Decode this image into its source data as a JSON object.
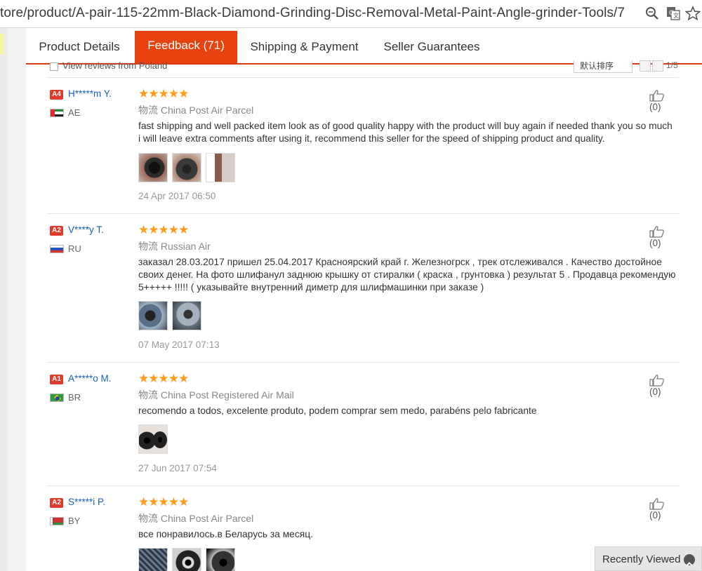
{
  "browser": {
    "url": "tore/product/A-pair-115-22mm-Black-Diamond-Grinding-Disc-Removal-Metal-Paint-Angle-grinder-Tools/7",
    "icons": [
      "zoom-icon",
      "translate-icon",
      "star-icon"
    ]
  },
  "tabs": [
    {
      "label": "Product Details",
      "active": false
    },
    {
      "label": "Feedback (71)",
      "active": true
    },
    {
      "label": "Shipping & Payment",
      "active": false
    },
    {
      "label": "Seller Guarantees",
      "active": false
    }
  ],
  "filter": {
    "view_label": "View reviews from Poland",
    "sort_label": "默认排序",
    "page": "1/5"
  },
  "reviews": [
    {
      "level": "A4",
      "user": "H*****m Y.",
      "country": "AE",
      "stars": "★★★★★",
      "ship_prefix": "物流",
      "shipping": "China Post Air Parcel",
      "text_lines": [
        "fast shipping and well packed item look as of good quality happy with the product will buy again if needed thank you so much",
        "i will leave extra comments after using it, recommend this seller for the speed of shipping product and quality."
      ],
      "date": "24 Apr 2017 06:50",
      "likes": "(0)"
    },
    {
      "level": "A2",
      "user": "V****y T.",
      "country": "RU",
      "stars": "★★★★★",
      "ship_prefix": "物流",
      "shipping": "Russian Air",
      "text_lines": [
        "заказал 28.03.2017 пришел 25.04.2017 Красноярский край г. Железногрск , трек отслеживался . Качество достойное",
        "своих денег. На фото шлифанул заднюю крышку от стиралки ( краска , грунтовка ) результат 5 . Продавца рекомендую",
        "5+++++ !!!!! ( указывайте внутренний диметр для шлифмашинки при заказе )"
      ],
      "date": "07 May 2017 07:13",
      "likes": "(0)"
    },
    {
      "level": "A1",
      "user": "A*****o M.",
      "country": "BR",
      "stars": "★★★★★",
      "ship_prefix": "物流",
      "shipping": "China Post Registered Air Mail",
      "text_lines": [
        "recomendo a todos, excelente produto, podem comprar sem medo, parabéns pelo fabricante"
      ],
      "date": "27 Jun 2017 07:54",
      "likes": "(0)"
    },
    {
      "level": "A2",
      "user": "S*****i P.",
      "country": "BY",
      "stars": "★★★★★",
      "ship_prefix": "物流",
      "shipping": "China Post Air Parcel",
      "text_lines": [
        "все понравилось.в Беларусь за месяц."
      ],
      "date": "",
      "likes": "(0)"
    }
  ],
  "recently_viewed": "Recently Viewed"
}
